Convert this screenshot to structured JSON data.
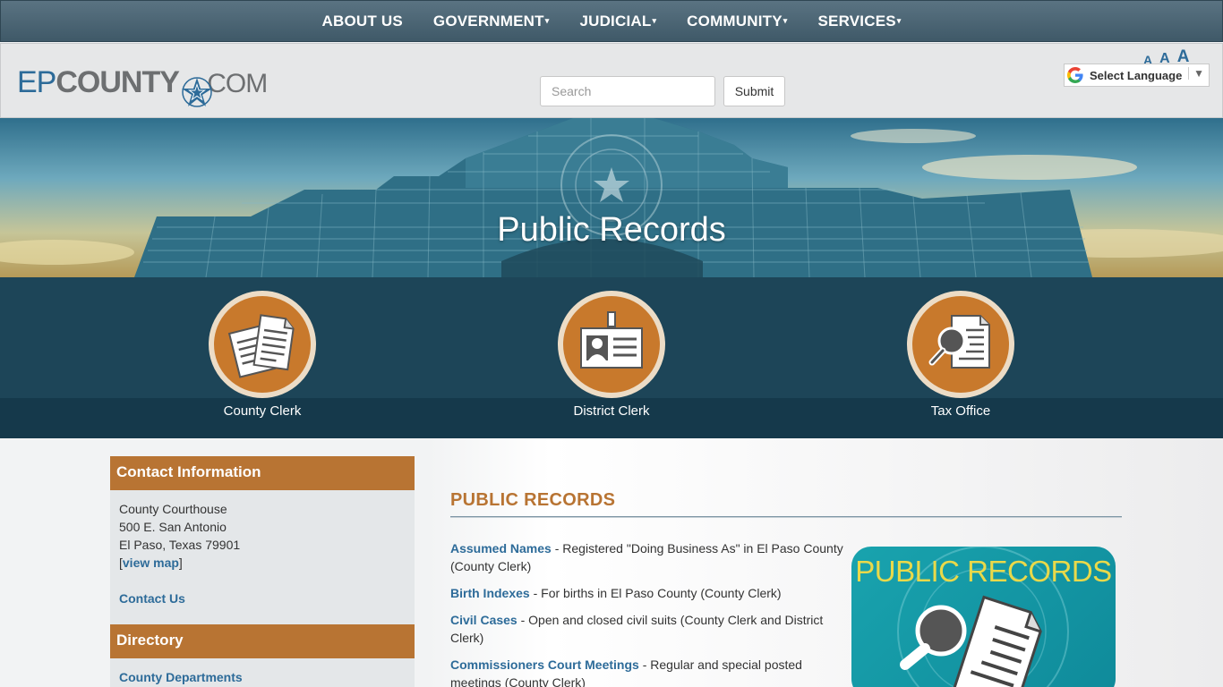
{
  "nav": {
    "items": [
      {
        "label": "ABOUT US",
        "caret": ""
      },
      {
        "label": "GOVERNMENT",
        "caret": "▾"
      },
      {
        "label": "JUDICIAL",
        "caret": "▾"
      },
      {
        "label": "COMMUNITY",
        "caret": "▾"
      },
      {
        "label": "SERVICES",
        "caret": "▾"
      }
    ]
  },
  "header": {
    "logo": {
      "ep": "EP",
      "county": "COUNTY",
      "com": ".COM"
    },
    "search_placeholder": "Search",
    "submit_label": "Submit",
    "font_sizes": [
      "A",
      "A",
      "A"
    ],
    "translate_label": "Select Language",
    "translate_arrow": "▼"
  },
  "hero": {
    "title": "Public Records"
  },
  "band": {
    "items": [
      {
        "label": "County Clerk",
        "icon": "documents-icon"
      },
      {
        "label": "District Clerk",
        "icon": "id-badge-icon"
      },
      {
        "label": "Tax Office",
        "icon": "document-search-icon"
      }
    ]
  },
  "sidebar": {
    "contact_heading": "Contact Information",
    "address_lines": [
      "County Courthouse",
      "500 E. San Antonio",
      "El Paso, Texas 79901"
    ],
    "map_link": "view map",
    "bracket_open": "[",
    "bracket_close": "]",
    "contact_link": "Contact Us",
    "directory_heading": "Directory",
    "directory_link": "County Departments"
  },
  "main": {
    "section_title": "PUBLIC RECORDS",
    "records": [
      {
        "title": "Assumed Names",
        "desc": " - Registered \"Doing Business As\" in El Paso County (County Clerk)"
      },
      {
        "title": "Birth Indexes",
        "desc": " - For births in El Paso County (County Clerk)"
      },
      {
        "title": "Civil Cases",
        "desc": " - Open and closed civil suits (County Clerk and District Clerk)"
      },
      {
        "title": "Commissioners Court Meetings",
        "desc": " - Regular and special posted meetings (County Clerk)"
      }
    ],
    "promo_text": "PUBLIC RECORDS"
  },
  "colors": {
    "nav_bg": "#4b6574",
    "accent_orange": "#b87433",
    "link_blue": "#2d6b99",
    "band_dark": "#1d4558"
  }
}
